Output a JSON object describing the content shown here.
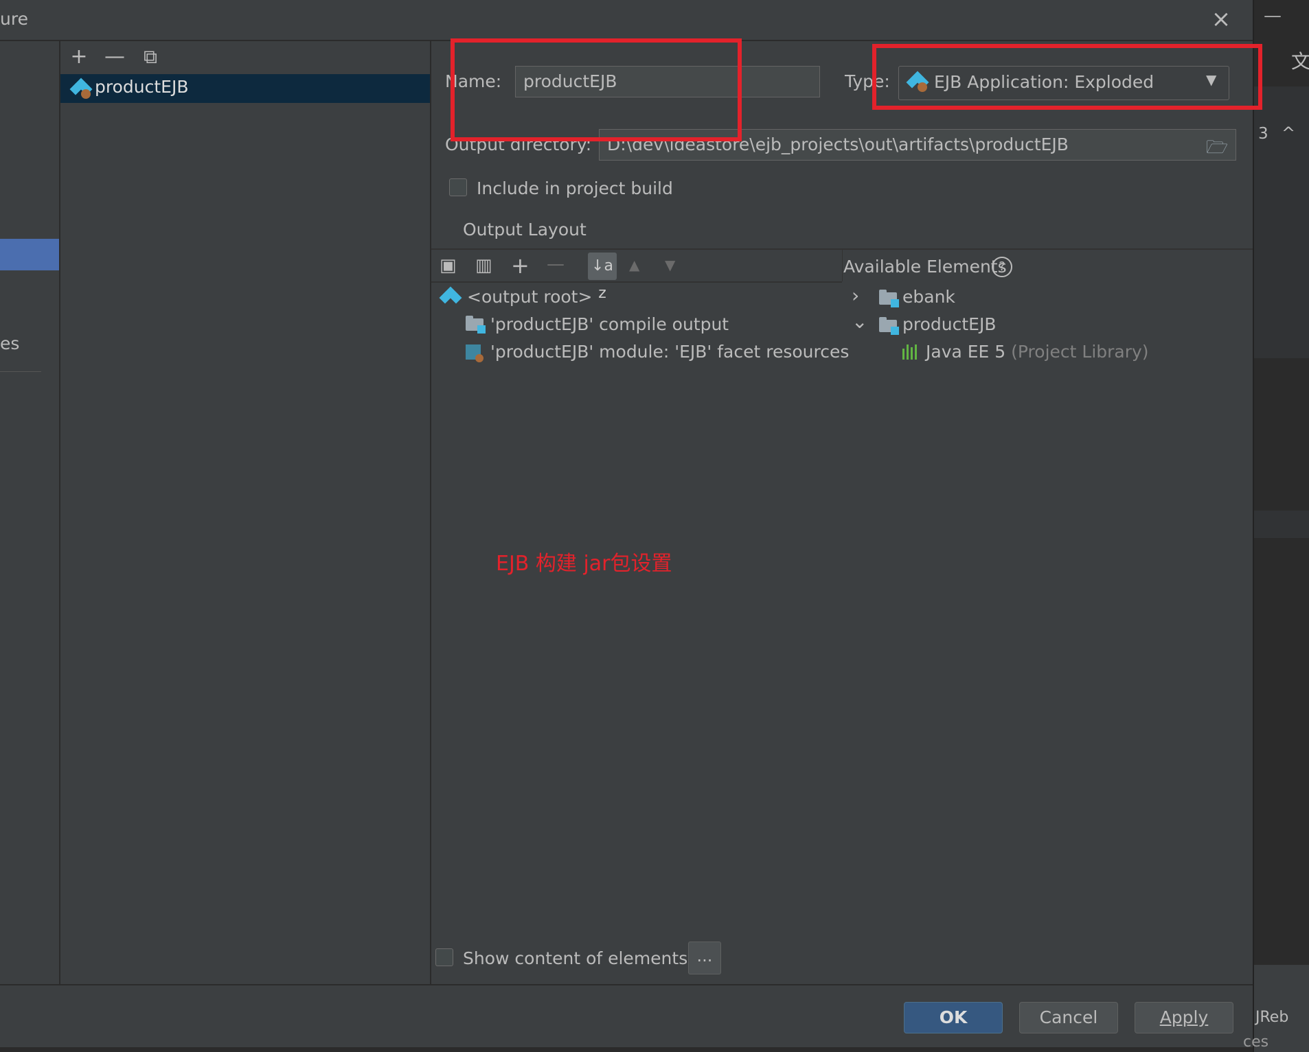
{
  "window": {
    "title": "ure",
    "close_glyph": "×"
  },
  "background_ide": {
    "minimize_glyph": "—",
    "number": "3",
    "caret": "^",
    "translate_glyph": "文",
    "jrebel_label": "JReb",
    "bottom_text": "ces"
  },
  "left_nav": {
    "partial_item": "es"
  },
  "artifact_list": {
    "toolbar": {
      "add": "+",
      "remove": "—",
      "copy": "⧉"
    },
    "items": [
      {
        "label": "productEJB",
        "icon": "ejb-icon"
      }
    ]
  },
  "form": {
    "name_label": "Name:",
    "name_value": "productEJB",
    "type_label": "Type:",
    "type_value": "EJB Application: Exploded",
    "output_dir_label": "Output directory:",
    "output_dir_value": "D:\\dev\\ideastore\\ejb_projects\\out\\artifacts\\productEJB",
    "include_label": "Include in project build",
    "include_checked": false
  },
  "layout": {
    "section_label": "Output Layout",
    "toolbar": {
      "new_dir": "▣",
      "archive": "▥",
      "add": "+",
      "remove": "—",
      "sort": "↓a z",
      "up": "▲",
      "down": "▼"
    },
    "tree": [
      {
        "label": "<output root>",
        "icon": "ejb-icon"
      },
      {
        "label": "'productEJB' compile output",
        "icon": "folder-icon"
      },
      {
        "label": "'productEJB' module: 'EJB' facet resources",
        "icon": "ejb-facet-icon"
      }
    ],
    "available_label": "Available Elements",
    "help_glyph": "?",
    "available": [
      {
        "label": "ebank",
        "expander": "›",
        "icon": "module-folder-icon"
      },
      {
        "label": "productEJB",
        "expander": "⌄",
        "icon": "module-folder-icon"
      },
      {
        "label": "Java EE 5",
        "suffix": "(Project Library)",
        "icon": "library-icon"
      }
    ],
    "show_content_label": "Show content of elements",
    "show_content_checked": false,
    "dots_label": "..."
  },
  "annotation": {
    "note": "EJB 构建 jar包设置",
    "color": "#e3222b"
  },
  "buttons": {
    "ok": "OK",
    "cancel": "Cancel",
    "apply": "Apply"
  },
  "colors": {
    "background": "#3c3f41",
    "selection": "#0d293e",
    "nav_selection": "#4b6eaf",
    "primary_button": "#365880",
    "accent_blue": "#40b6e0"
  }
}
